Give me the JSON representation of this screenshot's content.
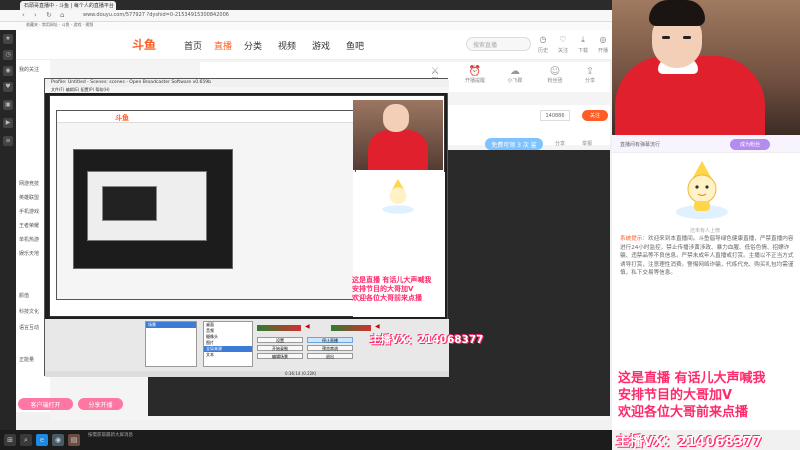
{
  "browser": {
    "tab_title": "石頭哥直播中 - 斗鱼 | 每个人的直播平台",
    "url": "www.douyu.com/577927 ?dyshid=0-21534915300842006",
    "bookmarks": "收藏夹  ·  常用网址  ·  斗鱼  ·  游戏  ·  视频"
  },
  "site": {
    "logo": "斗鱼",
    "nav": [
      "首页",
      "直播",
      "分类",
      "视频",
      "游戏",
      "鱼吧"
    ],
    "search_placeholder": "搜索直播",
    "header_icons": [
      {
        "name": "history",
        "label": "历史"
      },
      {
        "name": "follow",
        "label": "关注"
      },
      {
        "name": "download",
        "label": "下载"
      },
      {
        "name": "live",
        "label": "开播"
      },
      {
        "name": "msg",
        "label": "消息"
      },
      {
        "name": "user",
        "label": "我的"
      }
    ],
    "left_nav": [
      "我的关注",
      "网游竞技",
      "英雄联盟",
      "手机游戏",
      "王者荣耀",
      "单机热游",
      "娱乐天地",
      "颜值",
      "科技文化",
      "语言互动",
      "正能量"
    ],
    "categories": [
      "PK",
      "开播提醒",
      "小飞碟",
      "粉丝团",
      "分享"
    ],
    "follow_count": "140886",
    "follow_label": "关注",
    "gift_tag": "免费可领 3 次 鲨",
    "share": "分享",
    "report": "举报"
  },
  "chat": {
    "header": "直播间有弹幕流行",
    "badge": "成为粉丝",
    "mascot_caption": "还未有人上榜",
    "notice_tag": "系统提示：",
    "notice": "欢迎来到本直播间。斗鱼倡导绿色健康直播，严禁直播内容进行24小时监控，禁止传播涉黄涉政、暴力血腥、低俗色情、招嫖诈骗、违禁品等不良信息。严禁未成年人直播或打赏。主播以不正当方式诱导打赏，注意理性消费。警惕网络诈骗，代练代充、购买礼包均需谨慎，私下交易等信息。"
  },
  "overlay": {
    "lines": [
      "这是直播 有话儿大声喊我",
      "安排节目的大哥加V",
      "欢迎各位大哥前来点播"
    ],
    "anchor_vx": "主播VX：214068377",
    "mid_vx": "主播VX：214068377",
    "mid_lines": [
      "这是直播 有话儿大声喊我",
      "安排节目的大哥加V",
      "欢迎各位大哥前来点播"
    ]
  },
  "obs": {
    "title": "Profile: Untitled - Scenes: scenes - Open Broadcaster Software v0.659b",
    "menu": "文件(F)  编辑(E)  配置(P)  帮助(H)",
    "scenes_label": "场景：",
    "sources_label": "来源：",
    "scenes": [
      "场景"
    ],
    "sources": [
      "桌面",
      "音频",
      "摄像头",
      "图片",
      "全局来源",
      "文本"
    ],
    "buttons": [
      "设置",
      "停止直播",
      "开始录制",
      "预览串流",
      "编辑场景",
      "退出"
    ],
    "status": "0:36:14 (0.22K)"
  },
  "bottom": {
    "btn_left": "客户端打开",
    "btn_right": "分享开播",
    "tip": "按需获取最新大屏消息"
  },
  "colors": {
    "accent": "#ff5d23",
    "overlay_pink": "#ff2a6a"
  }
}
